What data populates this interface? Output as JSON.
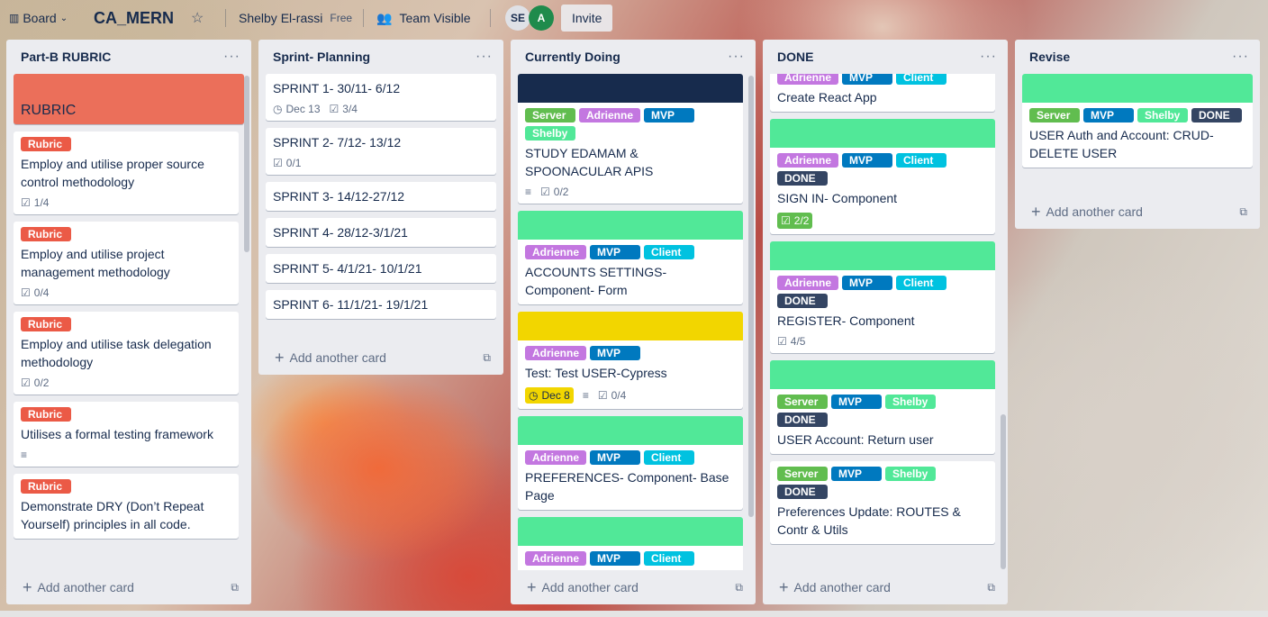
{
  "topbar": {
    "board_label": "Board",
    "title": "CA_MERN",
    "workspace": "Shelby El-rassi",
    "plan": "Free",
    "visibility": "Team Visible",
    "avatar_se": "SE",
    "avatar_a": "A",
    "invite_label": "Invite"
  },
  "colors": {
    "green": "#61bd4f",
    "purple": "#c377e0",
    "blue": "#0079bf",
    "sky": "#00c2e0",
    "lime": "#51e898",
    "red": "#eb5a46",
    "black": "#344563",
    "navy": "#172b4d",
    "yellow": "#f2d600",
    "rubric_cover": "#eb6f5a"
  },
  "footer_label": "Add another card",
  "lists": [
    {
      "title": "Part-B RUBRIC",
      "rubric_cover_text": "RUBRIC",
      "cards": [
        {
          "labels": [
            "Rubric"
          ],
          "title": "Employ and utilise proper source control methodology",
          "checklist": "1/4"
        },
        {
          "labels": [
            "Rubric"
          ],
          "title": "Employ and utilise project management methodology",
          "checklist": "0/4"
        },
        {
          "labels": [
            "Rubric"
          ],
          "title": "Employ and utilise task delegation methodology",
          "checklist": "0/2"
        },
        {
          "labels": [
            "Rubric"
          ],
          "title": "Utilises a formal testing framework"
        },
        {
          "labels": [
            "Rubric"
          ],
          "title": "Demonstrate DRY (Don’t Repeat Yourself) principles in all code."
        }
      ]
    },
    {
      "title": "Sprint- Planning",
      "cards": [
        {
          "title": "SPRINT 1- 30/11- 6/12",
          "due": "Dec 13",
          "checklist": "3/4"
        },
        {
          "title": "SPRINT 2- 7/12- 13/12",
          "checklist": "0/1"
        },
        {
          "title": "SPRINT 3- 14/12-27/12"
        },
        {
          "title": "SPRINT 4- 28/12-3/1/21"
        },
        {
          "title": "SPRINT 5- 4/1/21- 10/1/21"
        },
        {
          "title": "SPRINT 6- 11/1/21- 19/1/21"
        }
      ]
    },
    {
      "title": "Currently Doing",
      "cards": [
        {
          "labels": [
            "Server",
            "Adrienne",
            "MVP",
            "Shelby"
          ],
          "title": "STUDY EDAMAM & SPOONACULAR APIS",
          "checklist": "0/2"
        },
        {
          "labels": [
            "Adrienne",
            "MVP",
            "Client"
          ],
          "title": "ACCOUNTS SETTINGS- Component- Form"
        },
        {
          "labels": [
            "Adrienne",
            "MVP"
          ],
          "title": "Test: Test USER-Cypress",
          "due": "Dec 8",
          "checklist": "0/4"
        },
        {
          "labels": [
            "Adrienne",
            "MVP",
            "Client"
          ],
          "title": "PREFERENCES- Component- Base Page"
        },
        {
          "labels": [
            "Adrienne",
            "MVP",
            "Client"
          ]
        }
      ]
    },
    {
      "title": "DONE",
      "cards": [
        {
          "labels": [
            "Adrienne",
            "MVP",
            "Client"
          ],
          "title": "Create React App"
        },
        {
          "labels": [
            "Adrienne",
            "MVP",
            "Client",
            "DONE"
          ],
          "title": "SIGN IN- Component",
          "checklist": "2/2"
        },
        {
          "labels": [
            "Adrienne",
            "MVP",
            "Client",
            "DONE"
          ],
          "title": "REGISTER- Component",
          "checklist": "4/5"
        },
        {
          "labels": [
            "Server",
            "MVP",
            "Shelby",
            "DONE"
          ],
          "title": "USER Account: Return user"
        },
        {
          "labels": [
            "Server",
            "MVP",
            "Shelby",
            "DONE"
          ],
          "title": "Preferences Update: ROUTES & Contr & Utils"
        }
      ]
    },
    {
      "title": "Revise",
      "cards": [
        {
          "labels": [
            "Server",
            "MVP",
            "Shelby",
            "DONE"
          ],
          "title": "USER Auth and Account: CRUD- DELETE USER"
        }
      ]
    }
  ]
}
